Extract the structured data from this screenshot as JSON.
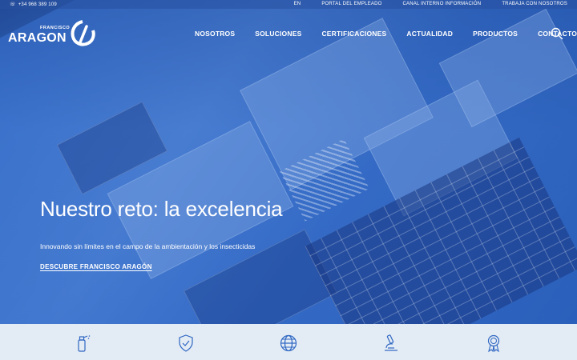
{
  "topbar": {
    "phone": "+34 968 389 109",
    "links": [
      "EN",
      "PORTAL DEL EMPLEADO",
      "CANAL INTERNO INFORMACIÓN",
      "TRABAJA CON NOSOTROS"
    ]
  },
  "logo": {
    "small": "FRANCISCO",
    "big": "ARAGON"
  },
  "nav": [
    "NOSOTROS",
    "SOLUCIONES",
    "CERTIFICACIONES",
    "ACTUALIDAD",
    "PRODUCTOS",
    "CONTACTO"
  ],
  "hero": {
    "title": "Nuestro reto: la excelencia",
    "subtitle": "Innovando sin límites en el campo de la ambientación y los insecticidas",
    "cta": "DESCUBRE FRANCISCO ARAGÓN"
  },
  "features": [
    {
      "icon": "spray-bottle-icon"
    },
    {
      "icon": "shield-check-icon"
    },
    {
      "icon": "globe-icon"
    },
    {
      "icon": "microscope-icon"
    },
    {
      "icon": "award-ribbon-icon"
    }
  ],
  "colors": {
    "brand_blue": "#2f67c2",
    "strip_bg": "#e3ebf5",
    "white": "#ffffff"
  }
}
